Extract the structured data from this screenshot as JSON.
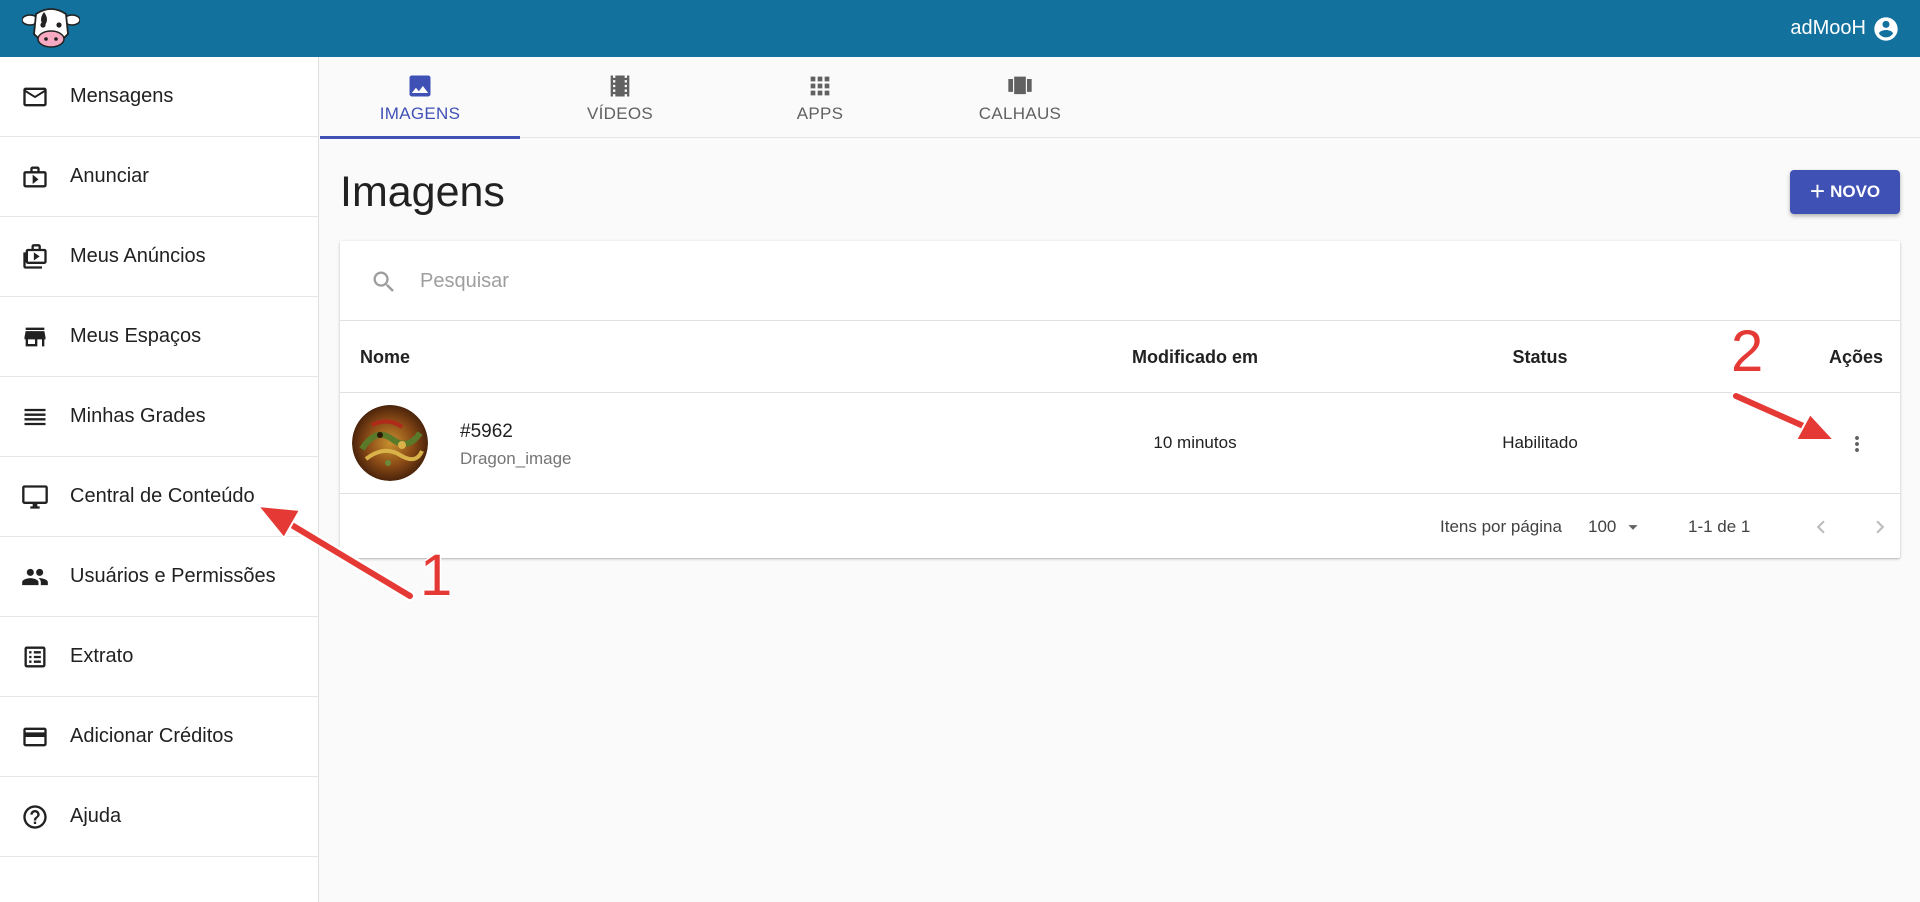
{
  "header": {
    "username": "adMooH"
  },
  "sidebar": {
    "items": [
      {
        "label": "Mensagens",
        "icon": "mail-icon"
      },
      {
        "label": "Anunciar",
        "icon": "briefcase-play-icon"
      },
      {
        "label": "Meus Anúncios",
        "icon": "ads-library-icon"
      },
      {
        "label": "Meus Espaços",
        "icon": "store-icon"
      },
      {
        "label": "Minhas Grades",
        "icon": "list-lines-icon"
      },
      {
        "label": "Central de Conteúdo",
        "icon": "monitor-icon"
      },
      {
        "label": "Usuários e Permissões",
        "icon": "people-icon"
      },
      {
        "label": "Extrato",
        "icon": "receipt-list-icon"
      },
      {
        "label": "Adicionar Créditos",
        "icon": "credit-card-icon"
      },
      {
        "label": "Ajuda",
        "icon": "help-circle-icon"
      }
    ]
  },
  "tabs": [
    {
      "label": "IMAGENS",
      "icon": "image-icon",
      "active": true
    },
    {
      "label": "VÍDEOS",
      "icon": "film-icon",
      "active": false
    },
    {
      "label": "APPS",
      "icon": "apps-grid-icon",
      "active": false
    },
    {
      "label": "CALHAUS",
      "icon": "carousel-icon",
      "active": false
    }
  ],
  "page": {
    "title": "Imagens",
    "new_button": "NOVO"
  },
  "search": {
    "placeholder": "Pesquisar"
  },
  "table": {
    "columns": [
      "Nome",
      "Modificado em",
      "Status",
      "Ações"
    ],
    "rows": [
      {
        "id": "#5962",
        "name": "Dragon_image",
        "modified": "10 minutos",
        "status": "Habilitado"
      }
    ]
  },
  "pagination": {
    "per_page_label": "Itens por página",
    "per_page_value": "100",
    "range": "1-1 de 1"
  },
  "annotations": {
    "marker_1": "1",
    "marker_2": "2"
  },
  "colors": {
    "topbar": "#13719e",
    "accent": "#3f51b5",
    "annotation": "#e53935"
  }
}
